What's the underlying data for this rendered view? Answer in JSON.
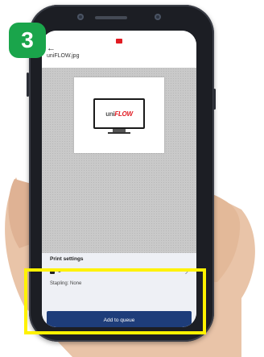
{
  "step": {
    "number": "3",
    "color": "#1aa54b"
  },
  "screen": {
    "file_name": "uniFLOW.jpg",
    "back_icon": "back-arrow-icon",
    "logo": {
      "part1": "uni",
      "part2": "FLOW"
    },
    "print_settings": {
      "title": "Print settings",
      "copies": "1",
      "stapling": "Stapling: None",
      "chevron_icon": "chevron-right-icon"
    },
    "add_button": "Add to queue"
  },
  "colors": {
    "brand_red": "#e11b22",
    "button_blue": "#1e3d7a",
    "highlight_yellow": "#fff200"
  }
}
